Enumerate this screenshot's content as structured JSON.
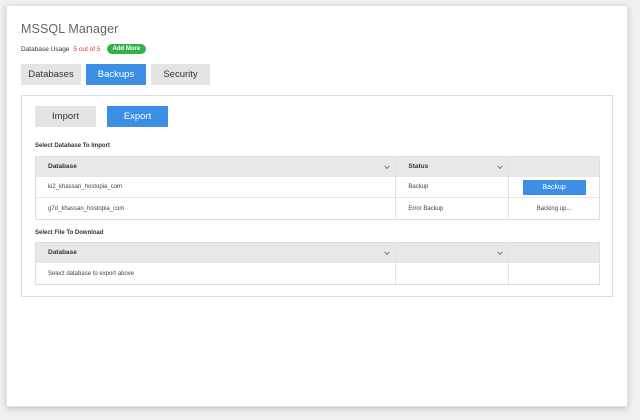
{
  "app": {
    "title": "MSSQL Manager"
  },
  "usage": {
    "label": "Database Usage",
    "count": "5 out of 5",
    "add_more_label": "Add More"
  },
  "tabs": [
    {
      "label": "Databases",
      "active": false
    },
    {
      "label": "Backups",
      "active": true
    },
    {
      "label": "Security",
      "active": false
    }
  ],
  "actions": {
    "import_label": "Import",
    "export_label": "Export"
  },
  "import_section": {
    "label": "Select Database To Import",
    "columns": [
      "Database",
      "Status",
      ""
    ],
    "rows": [
      {
        "database": "ki2_khassan_hostopia_com",
        "status": "Backup",
        "action": "Backup",
        "action_type": "button"
      },
      {
        "database": "g7d_khassan_hostopia_com",
        "status": "Error Backup",
        "action": "Backing up...",
        "action_type": "text"
      }
    ]
  },
  "download_section": {
    "label": "Select File To Download",
    "columns": [
      "Database",
      "",
      ""
    ],
    "rows": [
      {
        "database": "Select database to export above",
        "status": "",
        "action": ""
      }
    ]
  },
  "colors": {
    "accent": "#3d8fe6",
    "success": "#33b24a",
    "warning_text": "#e0302f",
    "inactive_tab": "#e4e4e4"
  },
  "icons": [
    "chevron-down-icon"
  ]
}
